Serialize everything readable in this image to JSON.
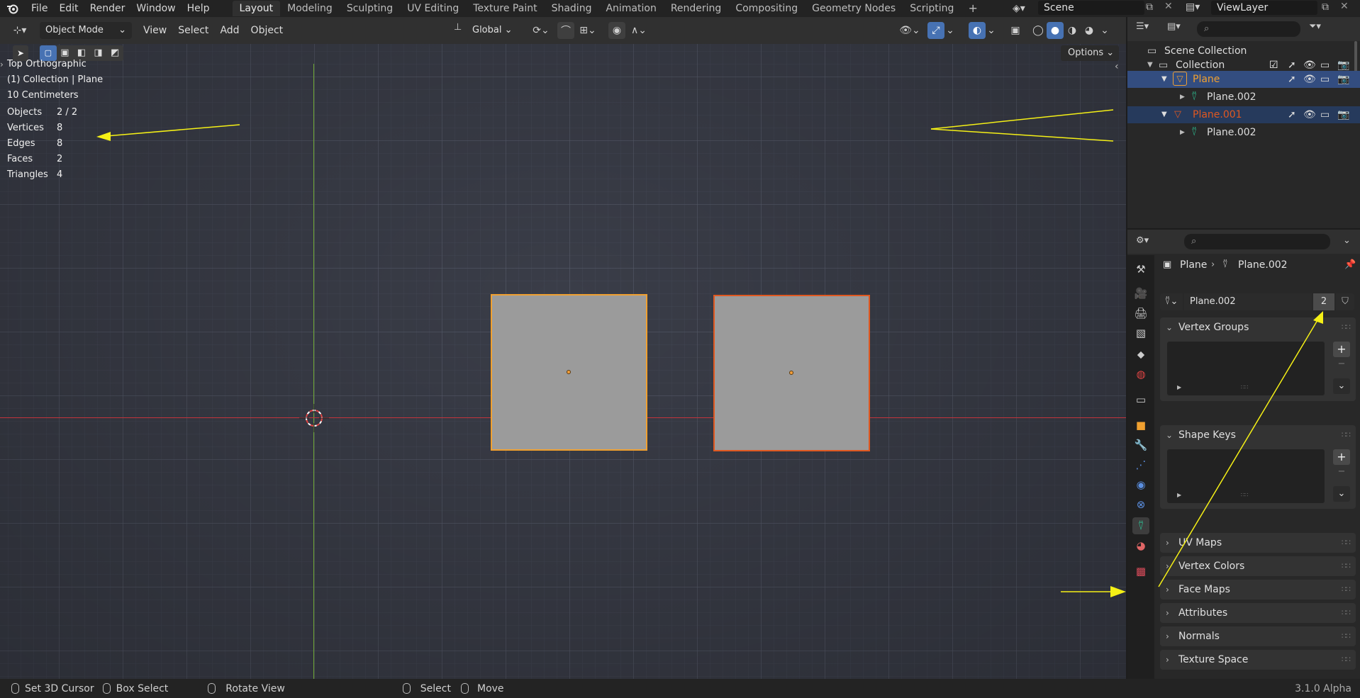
{
  "menu": [
    "File",
    "Edit",
    "Render",
    "Window",
    "Help"
  ],
  "workspaces": [
    {
      "label": "Layout",
      "active": true
    },
    {
      "label": "Modeling"
    },
    {
      "label": "Sculpting"
    },
    {
      "label": "UV Editing"
    },
    {
      "label": "Texture Paint"
    },
    {
      "label": "Shading"
    },
    {
      "label": "Animation"
    },
    {
      "label": "Rendering"
    },
    {
      "label": "Compositing"
    },
    {
      "label": "Geometry Nodes"
    },
    {
      "label": "Scripting"
    }
  ],
  "add_workspace": "+",
  "scene": "Scene",
  "view_layer": "ViewLayer",
  "viewport_header": {
    "mode": "Object Mode",
    "menus": [
      "View",
      "Select",
      "Add",
      "Object"
    ],
    "orientation": "Global",
    "options_label": "Options"
  },
  "viewport_overlay": {
    "view_name": "Top Orthographic",
    "collection_path": "(1) Collection | Plane",
    "scale": "10 Centimeters",
    "stats": [
      {
        "label": "Objects",
        "value": "2 / 2"
      },
      {
        "label": "Vertices",
        "value": "8"
      },
      {
        "label": "Edges",
        "value": "8"
      },
      {
        "label": "Faces",
        "value": "2"
      },
      {
        "label": "Triangles",
        "value": "4"
      }
    ]
  },
  "outliner": {
    "scene_collection": "Scene Collection",
    "collection": "Collection",
    "items": [
      {
        "label": "Plane",
        "type": "object",
        "selected": true
      },
      {
        "label": "Plane.002",
        "type": "mesh"
      },
      {
        "label": "Plane.001",
        "type": "object",
        "selected": true
      },
      {
        "label": "Plane.002",
        "type": "mesh"
      }
    ]
  },
  "properties": {
    "breadcrumb_object": "Plane",
    "breadcrumb_data": "Plane.002",
    "mesh_name": "Plane.002",
    "users": "2",
    "panels_open": [
      "Vertex Groups",
      "Shape Keys"
    ],
    "panels_closed": [
      "UV Maps",
      "Vertex Colors",
      "Face Maps",
      "Attributes",
      "Normals",
      "Texture Space"
    ]
  },
  "statusbar": {
    "items": [
      "Set 3D Cursor",
      "Box Select",
      "Rotate View",
      "Select",
      "Move"
    ],
    "version": "3.1.0 Alpha"
  },
  "colors": {
    "selected_active": "#f0a030",
    "selected": "#e05820",
    "mesh_icon": "#2dd4a0",
    "annotation": "#f5f016",
    "x_axis": "#c4343c",
    "y_axis": "#6ea635"
  }
}
